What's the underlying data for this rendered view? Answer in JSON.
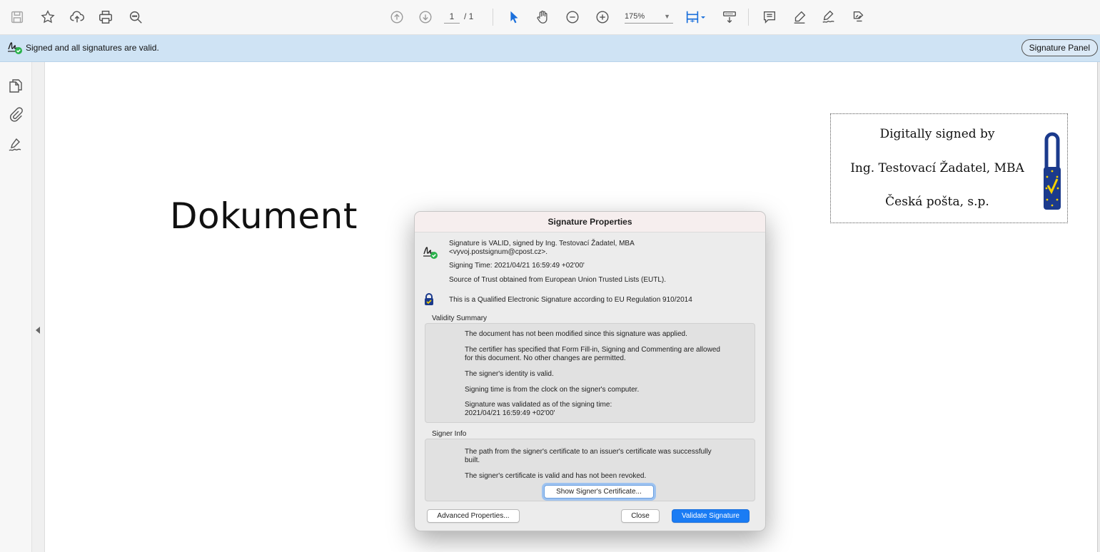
{
  "toolbar": {
    "page_current": "1",
    "page_total": "/ 1",
    "zoom": "175%",
    "icons": [
      "save-icon",
      "bookmark-star-icon",
      "upload-cloud-icon",
      "print-icon",
      "zoom-search-icon",
      "page-up-icon",
      "page-down-icon",
      "select-arrow-icon",
      "hand-tool-icon",
      "zoom-out-icon",
      "zoom-in-icon",
      "fit-page-icon",
      "scroll-mode-icon",
      "comment-icon",
      "highlight-pen-icon",
      "sign-icon",
      "share-icon"
    ]
  },
  "sigbar": {
    "message": "Signed and all signatures are valid.",
    "panel_button": "Signature Panel"
  },
  "document": {
    "title": "Dokument",
    "stamp": {
      "line1": "Digitally signed by",
      "line2": "Ing. Testovací Žadatel, MBA",
      "line3": "Česká pošta, s.p."
    }
  },
  "dialog": {
    "title": "Signature Properties",
    "status_line1": "Signature is VALID, signed by Ing. Testovací Žadatel, MBA",
    "status_line2": "<vyvoj.postsignum@cpost.cz>.",
    "signing_time": "Signing Time:  2021/04/21 16:59:49 +02'00'",
    "trust_source": "Source of Trust obtained from European Union Trusted Lists (EUTL).",
    "qualified": "This is a Qualified Electronic Signature according to EU Regulation 910/2014",
    "validity_label": "Validity Summary",
    "validity": {
      "v1": "The document has not been modified since this signature was applied.",
      "v2a": "The certifier has specified that Form Fill-in, Signing and Commenting are allowed",
      "v2b": "for this document. No other changes are permitted.",
      "v3": "The signer's identity is valid.",
      "v4": "Signing time is from the clock on the signer's computer.",
      "v5a": "Signature was validated as of the signing time:",
      "v5b": "2021/04/21 16:59:49 +02'00'"
    },
    "signer_label": "Signer Info",
    "signer": {
      "s1a": "The path from the signer's certificate to an issuer's certificate was successfully",
      "s1b": "built.",
      "s2": "The signer's certificate is valid and has not been revoked."
    },
    "buttons": {
      "show_cert": "Show Signer's Certificate...",
      "advanced": "Advanced Properties...",
      "close": "Close",
      "validate": "Validate Signature"
    }
  },
  "colors": {
    "sigbar_bg": "#cfe3f4",
    "accent_blue": "#1a7cf4",
    "valid_green": "#2bb24c",
    "eu_blue": "#1b3a8c"
  }
}
